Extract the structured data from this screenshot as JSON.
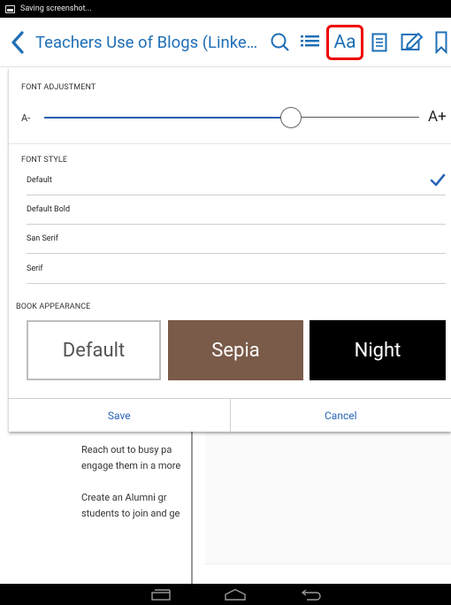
{
  "status_bar": {
    "text": "Saving screenshot..."
  },
  "app_bar": {
    "title": "Teachers Use of Blogs (Linke…",
    "icons": [
      "back-icon",
      "search-icon",
      "toc-icon",
      "font-settings-icon",
      "notes-icon",
      "annotate-icon",
      "bookmark-icon"
    ],
    "font_button_label": "Aa",
    "accent_color": "#1f6fb7",
    "highlight_color": "#e00000"
  },
  "font_adjustment": {
    "label": "FONT ADJUSTMENT",
    "decrease_label": "A-",
    "increase_label": "A+",
    "level": 0.69
  },
  "font_style": {
    "label": "FONT STYLE",
    "options": [
      "Default",
      "Default Bold",
      "San Serif",
      "Serif"
    ],
    "selected": "Default"
  },
  "book_appearance": {
    "label": "BOOK APPEARANCE",
    "themes": [
      "Default",
      "Sepia",
      "Night"
    ]
  },
  "actions": {
    "save": "Save",
    "cancel": "Cancel"
  },
  "page_content": {
    "bullets": [
      [
        "Reach out to busy pa",
        "engage them in a more"
      ],
      [
        "Create an Alumni gr",
        "students to join and ge"
      ]
    ]
  },
  "nav_bar": {
    "icons": [
      "recent-apps-icon",
      "home-icon",
      "back-nav-icon"
    ]
  }
}
